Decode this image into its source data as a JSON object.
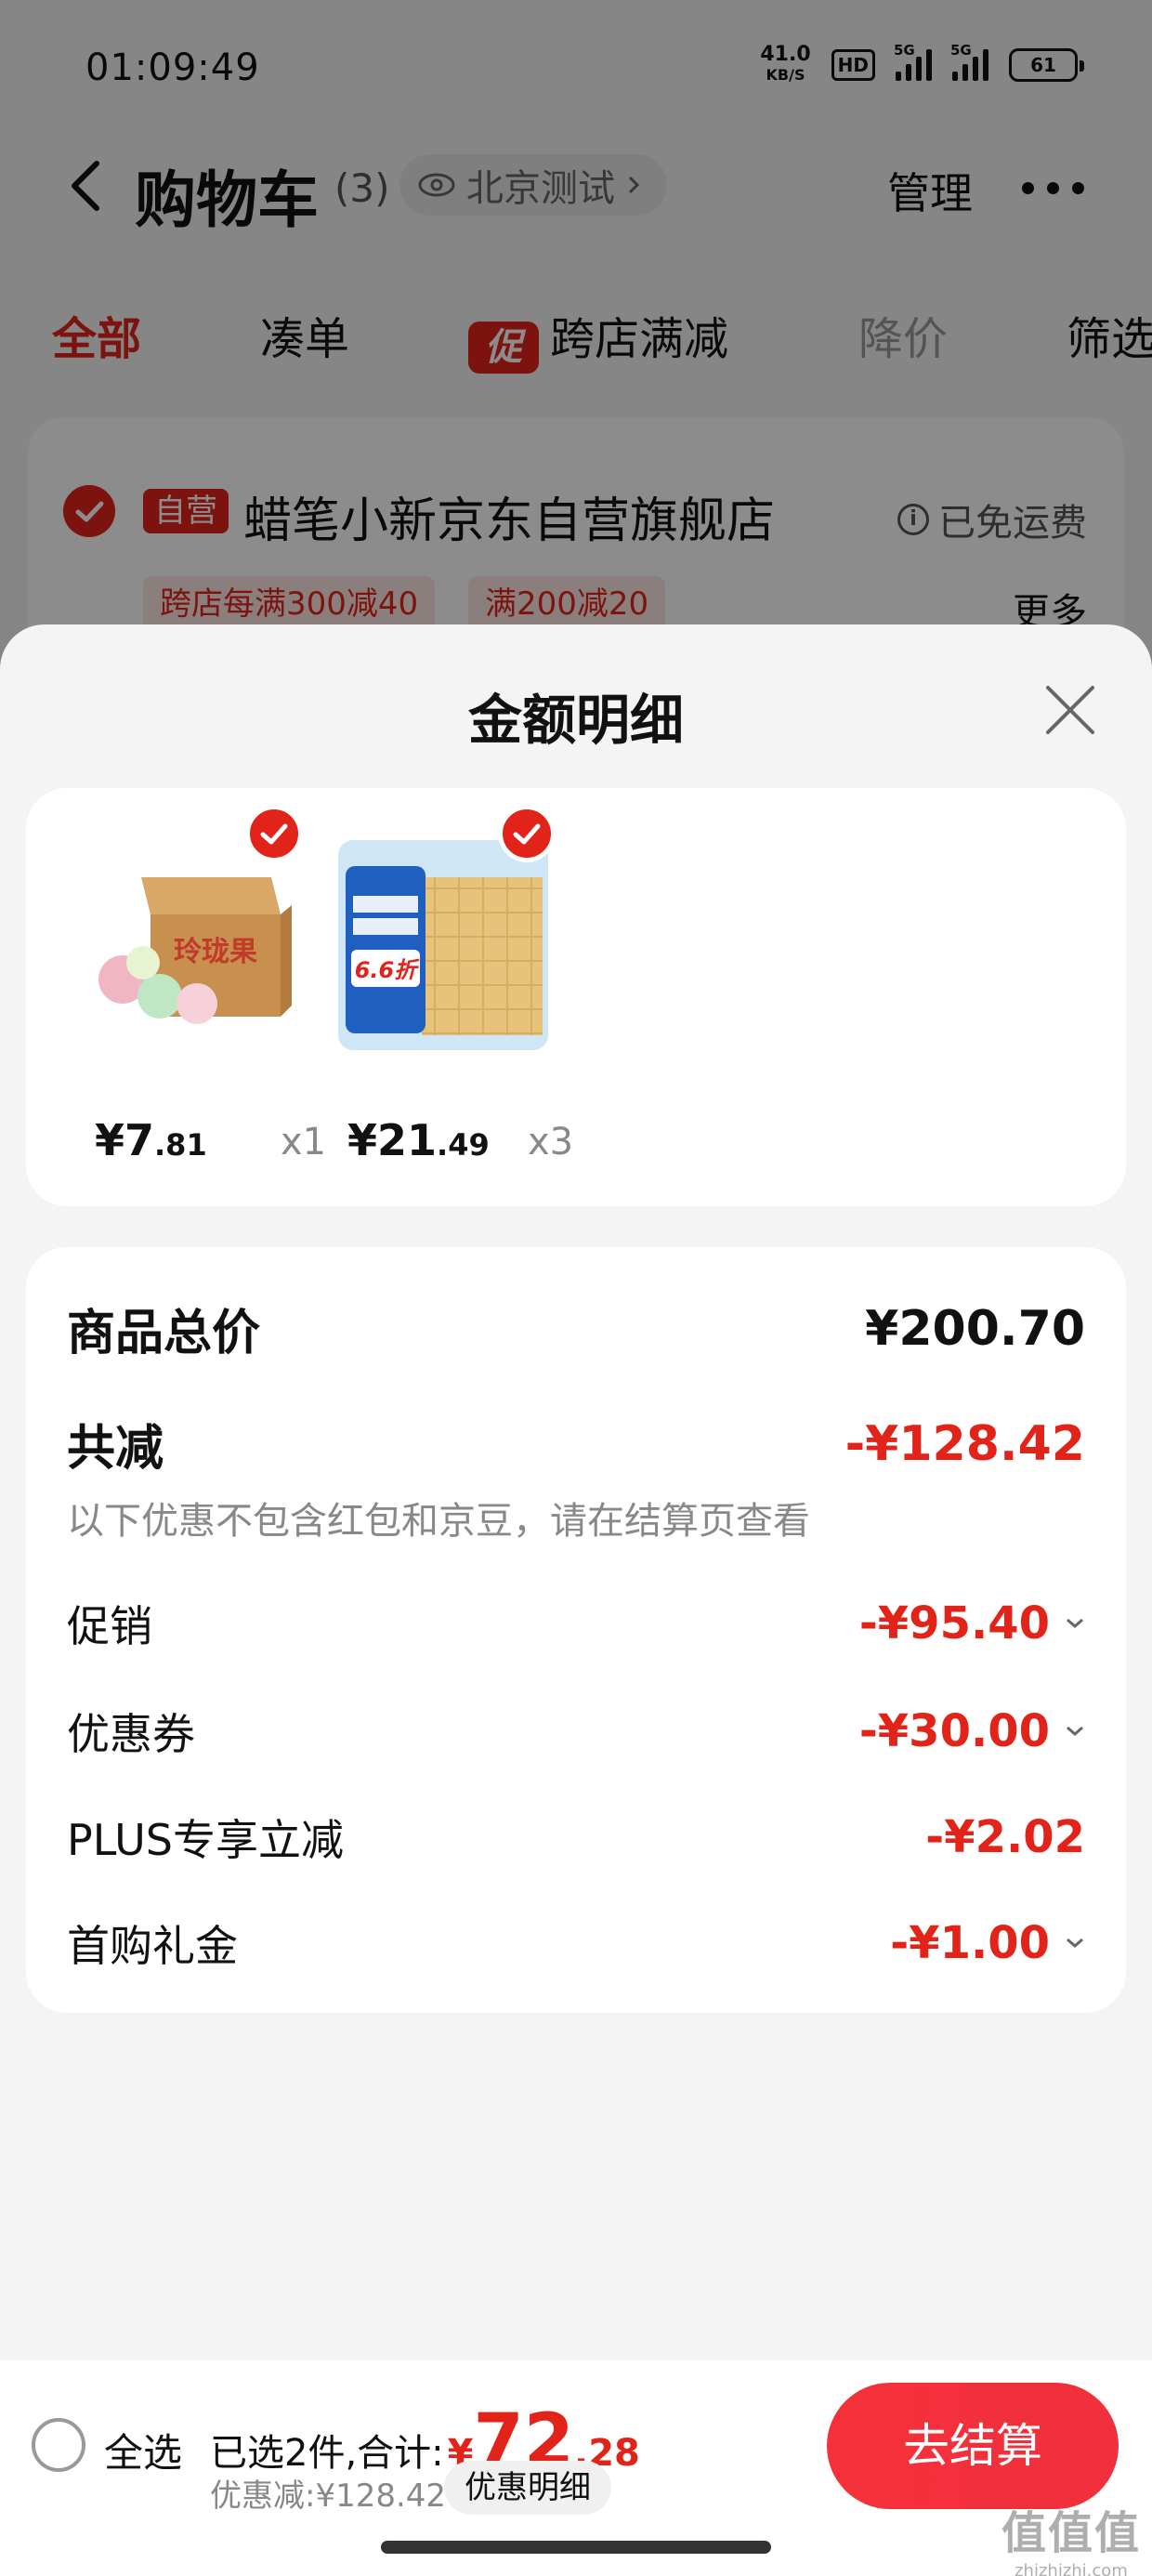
{
  "status_bar": {
    "time": "01:09:49",
    "net_speed": "41.0",
    "net_unit": "KB/S",
    "hd_label": "HD",
    "signal_1": "5G",
    "signal_2": "5G",
    "battery": "61"
  },
  "nav": {
    "title": "购物车",
    "count": "(3)",
    "location": "北京测试",
    "manage": "管理"
  },
  "tabs": [
    {
      "label": "全部"
    },
    {
      "label": "凑单"
    },
    {
      "label": "跨店满减",
      "icon_text": "促"
    },
    {
      "label": "降价"
    },
    {
      "label": "筛选"
    }
  ],
  "store": {
    "self_badge": "自营",
    "name": "蜡笔小新京东自营旗舰店",
    "shipping": "已免运费",
    "promos": [
      "跨店每满300减40",
      "满200减20"
    ],
    "more": "更多"
  },
  "sheet": {
    "title": "金额明细",
    "items": [
      {
        "price_int": "¥7",
        "price_dec": ".81",
        "qty": "x1",
        "thumb_text": "玲珑果",
        "icon": "jelly-box-image"
      },
      {
        "price_int": "¥21",
        "price_dec": ".49",
        "qty": "x3",
        "thumb_text": "6.6折",
        "icon": "tissue-pack-image"
      }
    ],
    "summary": {
      "total_label": "商品总价",
      "total_value": "¥200.70",
      "reduce_label": "共减",
      "reduce_value": "-¥128.42",
      "note": "以下优惠不包含红包和京豆，请在结算页查看",
      "lines": [
        {
          "label": "促销",
          "value": "-¥95.40",
          "expandable": true
        },
        {
          "label": "优惠券",
          "value": "-¥30.00",
          "expandable": true
        },
        {
          "label": "PLUS专享立减",
          "value": "-¥2.02",
          "expandable": false
        },
        {
          "label": "首购礼金",
          "value": "-¥1.00",
          "expandable": true
        }
      ]
    }
  },
  "bottom_bar": {
    "select_all": "全选",
    "selected_text": "已选2件,合计:",
    "currency": "¥",
    "total_int": "72",
    "total_dec": ".28",
    "discount_text": "优惠减:¥128.42",
    "detail_button": "优惠明细",
    "checkout": "去结算"
  },
  "watermark": {
    "main": "值值值",
    "sub": "zhizhizhi.com"
  },
  "colors": {
    "accent": "#e2231a",
    "sheet_bg": "#f4f4f4",
    "card_bg": "#ffffff"
  }
}
